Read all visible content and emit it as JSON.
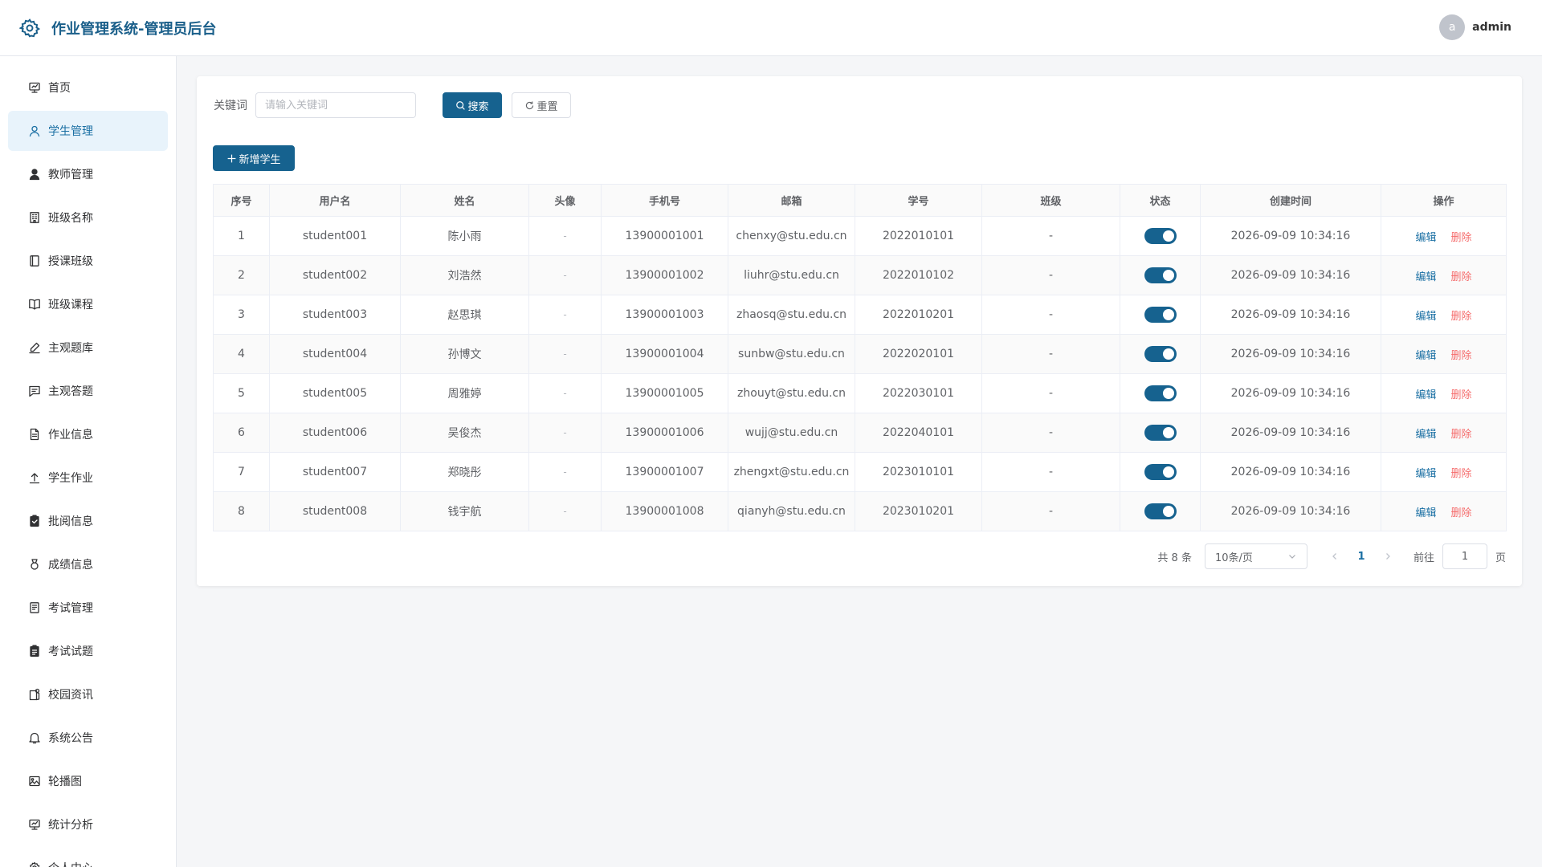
{
  "header": {
    "title": "作业管理系统-管理员后台",
    "avatar_letter": "a",
    "username": "admin",
    "accent_color": "#1a5f8a"
  },
  "sidebar": {
    "items": [
      {
        "label": "首页",
        "icon": "chart-board-icon",
        "active": false
      },
      {
        "label": "学生管理",
        "icon": "user-icon",
        "active": true
      },
      {
        "label": "教师管理",
        "icon": "user-filled-icon",
        "active": false
      },
      {
        "label": "班级名称",
        "icon": "office-building-icon",
        "active": false
      },
      {
        "label": "授课班级",
        "icon": "notebook-icon",
        "active": false
      },
      {
        "label": "班级课程",
        "icon": "reading-icon",
        "active": false
      },
      {
        "label": "主观题库",
        "icon": "edit-pen-icon",
        "active": false
      },
      {
        "label": "主观答题",
        "icon": "chat-square-icon",
        "active": false
      },
      {
        "label": "作业信息",
        "icon": "document-icon",
        "active": false
      },
      {
        "label": "学生作业",
        "icon": "upload-icon",
        "active": false
      },
      {
        "label": "批阅信息",
        "icon": "finished-icon",
        "active": false
      },
      {
        "label": "成绩信息",
        "icon": "medal-icon",
        "active": false
      },
      {
        "label": "考试管理",
        "icon": "tickets-icon",
        "active": false
      },
      {
        "label": "考试试题",
        "icon": "clipboard-icon",
        "active": false
      },
      {
        "label": "校园资讯",
        "icon": "news-icon",
        "active": false
      },
      {
        "label": "系统公告",
        "icon": "bell-icon",
        "active": false
      },
      {
        "label": "轮播图",
        "icon": "picture-icon",
        "active": false
      },
      {
        "label": "统计分析",
        "icon": "data-board-icon",
        "active": false
      },
      {
        "label": "个人中心",
        "icon": "setting-icon",
        "active": false
      }
    ]
  },
  "search": {
    "label": "关键词",
    "placeholder": "请输入关键词",
    "value": "",
    "search_label": "搜索",
    "reset_label": "重置"
  },
  "toolbar": {
    "add_label": "新增学生"
  },
  "table": {
    "columns": [
      "序号",
      "用户名",
      "姓名",
      "头像",
      "手机号",
      "邮箱",
      "学号",
      "班级",
      "状态",
      "创建时间",
      "操作"
    ],
    "edit_label": "编辑",
    "delete_label": "删除",
    "rows": [
      {
        "index": "1",
        "username": "student001",
        "name": "陈小雨",
        "avatar": "-",
        "phone": "13900001001",
        "email": "chenxy@stu.edu.cn",
        "student_no": "2022010101",
        "class": "-",
        "status": true,
        "created": "2026-09-09 10:34:16"
      },
      {
        "index": "2",
        "username": "student002",
        "name": "刘浩然",
        "avatar": "-",
        "phone": "13900001002",
        "email": "liuhr@stu.edu.cn",
        "student_no": "2022010102",
        "class": "-",
        "status": true,
        "created": "2026-09-09 10:34:16"
      },
      {
        "index": "3",
        "username": "student003",
        "name": "赵思琪",
        "avatar": "-",
        "phone": "13900001003",
        "email": "zhaosq@stu.edu.cn",
        "student_no": "2022010201",
        "class": "-",
        "status": true,
        "created": "2026-09-09 10:34:16"
      },
      {
        "index": "4",
        "username": "student004",
        "name": "孙博文",
        "avatar": "-",
        "phone": "13900001004",
        "email": "sunbw@stu.edu.cn",
        "student_no": "2022020101",
        "class": "-",
        "status": true,
        "created": "2026-09-09 10:34:16"
      },
      {
        "index": "5",
        "username": "student005",
        "name": "周雅婷",
        "avatar": "-",
        "phone": "13900001005",
        "email": "zhouyt@stu.edu.cn",
        "student_no": "2022030101",
        "class": "-",
        "status": true,
        "created": "2026-09-09 10:34:16"
      },
      {
        "index": "6",
        "username": "student006",
        "name": "吴俊杰",
        "avatar": "-",
        "phone": "13900001006",
        "email": "wujj@stu.edu.cn",
        "student_no": "2022040101",
        "class": "-",
        "status": true,
        "created": "2026-09-09 10:34:16"
      },
      {
        "index": "7",
        "username": "student007",
        "name": "郑晓彤",
        "avatar": "-",
        "phone": "13900001007",
        "email": "zhengxt@stu.edu.cn",
        "student_no": "2023010101",
        "class": "-",
        "status": true,
        "created": "2026-09-09 10:34:16"
      },
      {
        "index": "8",
        "username": "student008",
        "name": "钱宇航",
        "avatar": "-",
        "phone": "13900001008",
        "email": "qianyh@stu.edu.cn",
        "student_no": "2023010201",
        "class": "-",
        "status": true,
        "created": "2026-09-09 10:34:16"
      }
    ]
  },
  "pagination": {
    "total_text": "共 8 条",
    "page_size": "10条/页",
    "current_page": "1",
    "goto_label": "前往",
    "goto_value": "1",
    "goto_suffix": "页"
  }
}
